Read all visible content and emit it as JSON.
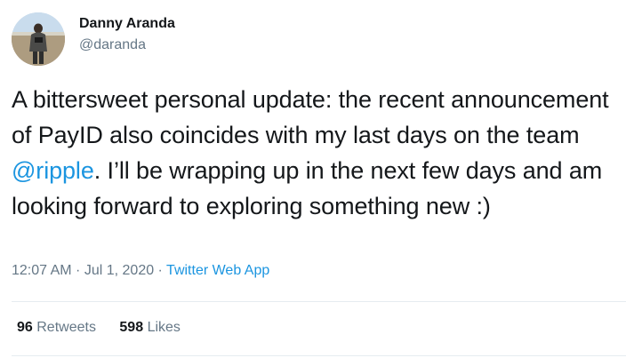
{
  "author": {
    "name": "Danny Aranda",
    "handle": "@daranda"
  },
  "tweet": {
    "text_part1": "A bittersweet personal update: the recent announcement of PayID also coincides with my last days on the team ",
    "mention": "@ripple",
    "text_part2": ".  I’ll be wrapping up in the next few days and am looking forward to exploring something new :)"
  },
  "meta": {
    "time": "12:07 AM",
    "separator1": " · ",
    "date": "Jul 1, 2020",
    "separator2": " · ",
    "source": "Twitter Web App"
  },
  "stats": {
    "retweets_count": "96",
    "retweets_label": "Retweets",
    "likes_count": "598",
    "likes_label": "Likes"
  },
  "colors": {
    "text": "#14171a",
    "secondary": "#657786",
    "link": "#1b95e0",
    "divider": "#e6ecf0"
  },
  "icons": {
    "avatar": "profile-photo"
  }
}
